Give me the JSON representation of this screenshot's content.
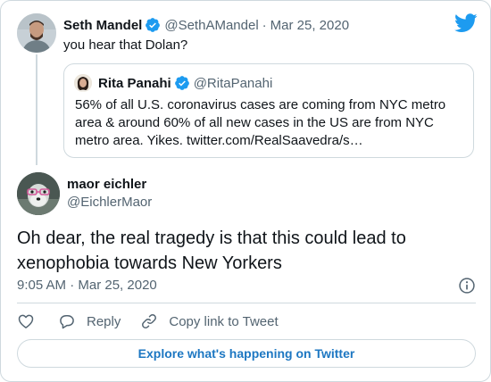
{
  "colors": {
    "twitter_blue": "#1d9bf0",
    "link_blue": "#1d77c2",
    "secondary_text": "#536471",
    "border": "#cfd9de"
  },
  "icons": {
    "brand": "twitter-bird-icon",
    "verified": "verified-badge-icon",
    "info": "info-icon",
    "like": "heart-icon",
    "reply": "reply-bubble-icon",
    "copy_link": "link-icon"
  },
  "parent_tweet": {
    "name": "Seth Mandel",
    "handle": "@SethAMandel",
    "separator": "·",
    "date": "Mar 25, 2020",
    "text": "you hear that Dolan?",
    "quoted": {
      "name": "Rita Panahi",
      "handle": "@RitaPanahi",
      "text": "56% of all U.S. coronavirus cases are coming from NYC metro area & around 60% of all new cases in the US are from NYC metro area. Yikes. twitter.com/RealSaavedra/s…"
    }
  },
  "main_tweet": {
    "name": "maor eichler",
    "handle": "@EichlerMaor",
    "text": "Oh dear, the real tragedy is that this could lead to xenophobia towards New Yorkers",
    "timestamp": "9:05 AM · Mar 25, 2020"
  },
  "actions": {
    "reply_label": "Reply",
    "copy_link_label": "Copy link to Tweet"
  },
  "footer": {
    "explore_label": "Explore what's happening on Twitter"
  }
}
